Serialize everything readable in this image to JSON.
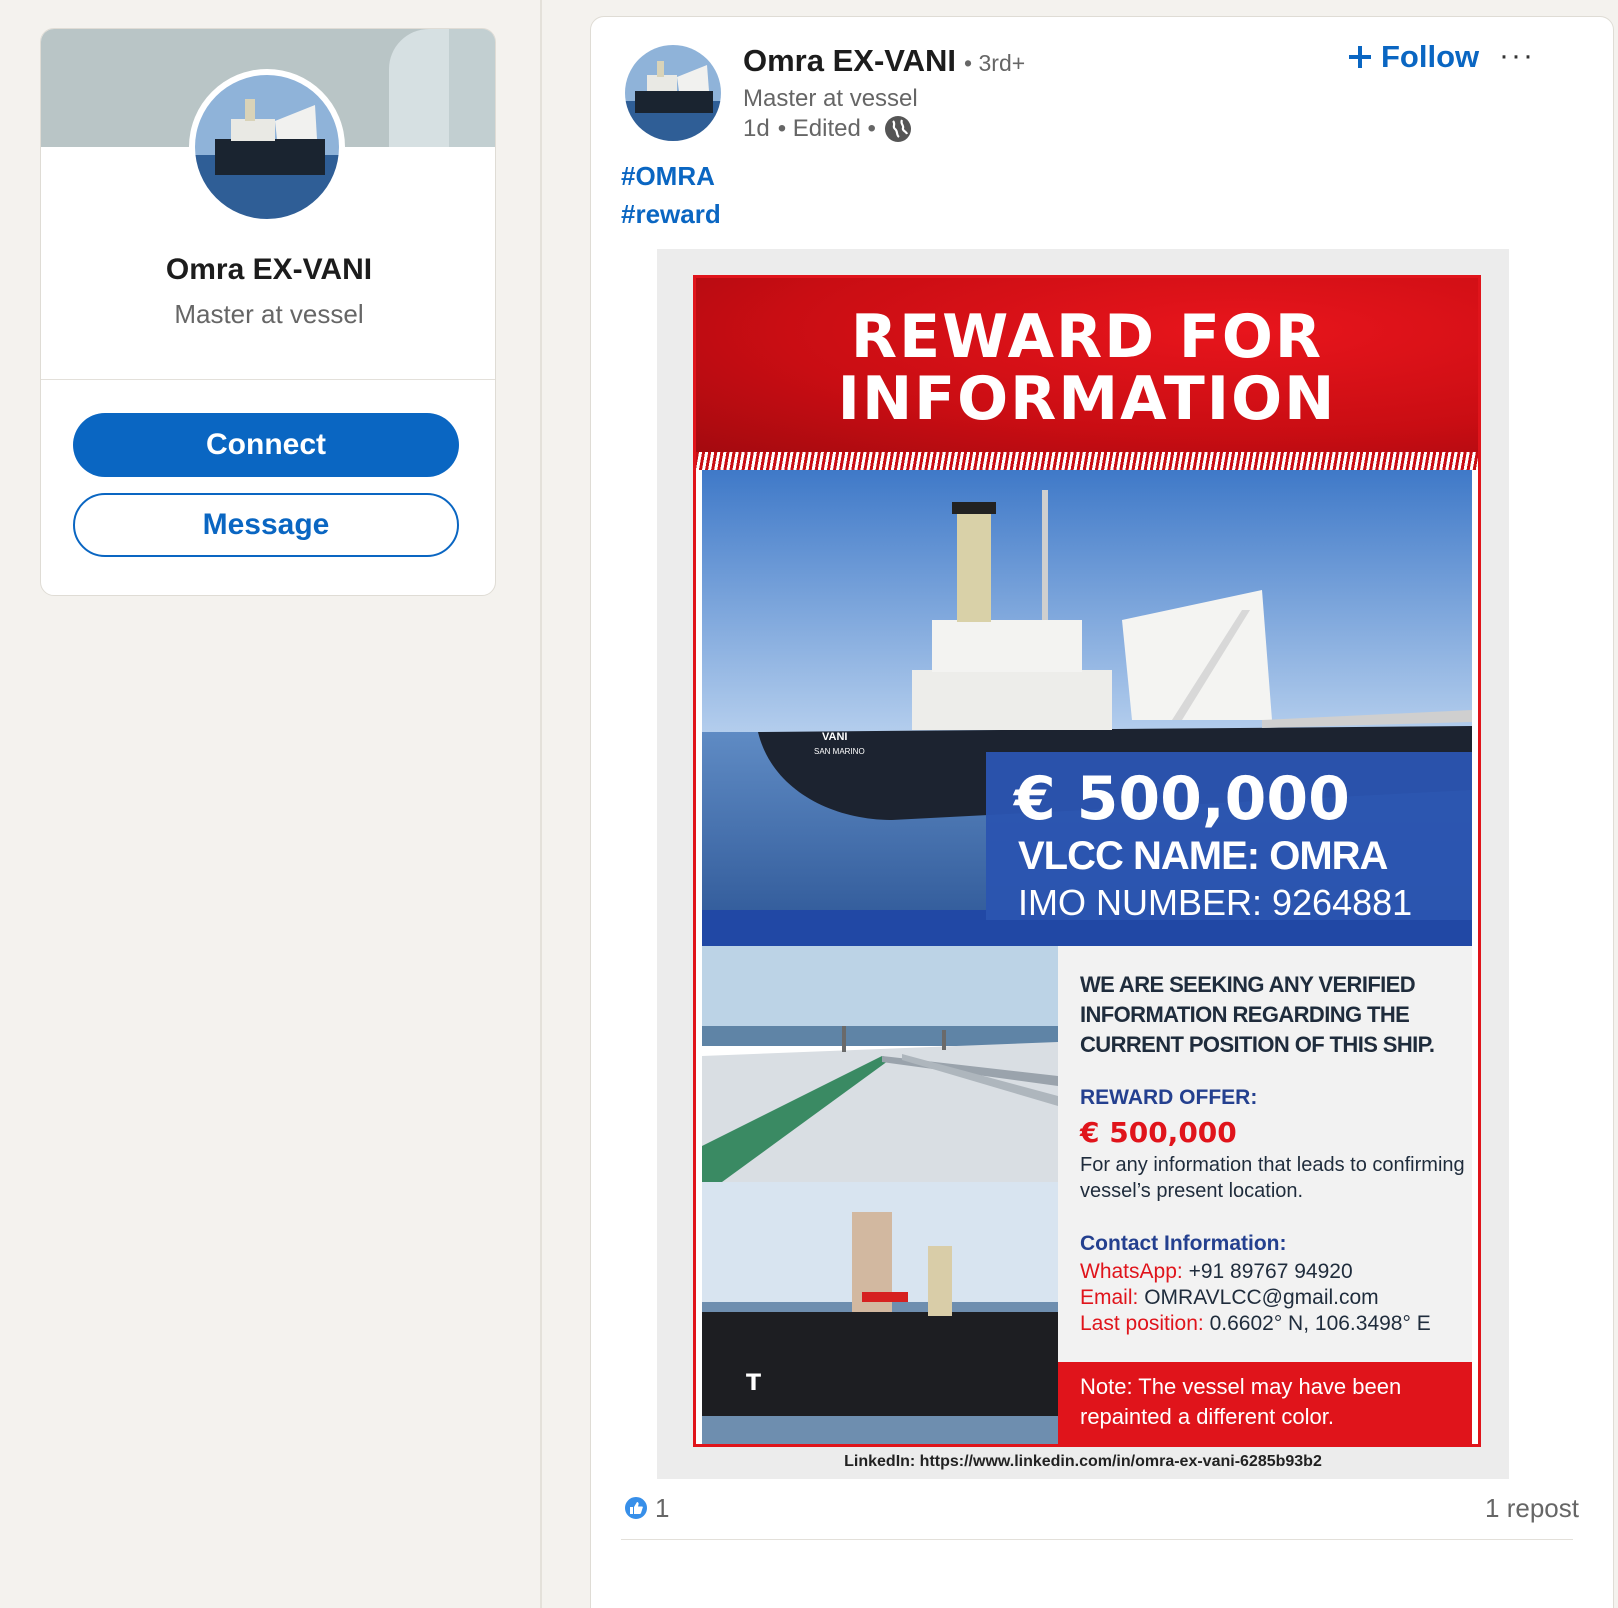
{
  "sidebar_profile": {
    "name": "Omra EX-VANI",
    "headline": "Master at vessel",
    "connect_label": "Connect",
    "message_label": "Message"
  },
  "post": {
    "author_name": "Omra EX-VANI",
    "degree": "• 3rd+",
    "headline": "Master at vessel",
    "time": "1d",
    "edited": "• Edited •",
    "follow_label": "Follow",
    "more_label": "···",
    "hashtags": [
      "#OMRA",
      "#reward"
    ],
    "reactions_count": "1",
    "reposts": "1 repost"
  },
  "poster": {
    "title_line1": "REWARD FOR",
    "title_line2": "INFORMATION",
    "price": "€ 500,000",
    "vlcc_name": "VLCC NAME: OMRA",
    "imo": "IMO NUMBER: 9264881",
    "ship_hull_text": [
      "VANI",
      "SAN MARINO"
    ],
    "seeking_text": "WE ARE SEEKING ANY VERIFIED INFORMATION REGARDING THE CURRENT POSITION OF THIS SHIP.",
    "offer_label": "REWARD OFFER:",
    "offer_amount": "€ 500,000",
    "offer_desc": "For any information that leads to confirming vessel’s present location.",
    "contact_label": "Contact Information:",
    "whatsapp_key": "WhatsApp:",
    "whatsapp_value": "+91 89767 94920",
    "email_key": "Email:",
    "email_value": "OMRAVLCC@gmail.com",
    "position_key": "Last position:",
    "position_value": "0.6602° N, 106.3498° E",
    "note": "Note: The vessel may have been repainted a different color.",
    "footer": "LinkedIn: https://www.linkedin.com/in/omra-ex-vani-6285b93b2"
  },
  "colors": {
    "linkedin_blue": "#0a66c2",
    "poster_red": "#e0141b",
    "poster_blue": "#2b54b0",
    "page_bg": "#f4f2ee"
  }
}
